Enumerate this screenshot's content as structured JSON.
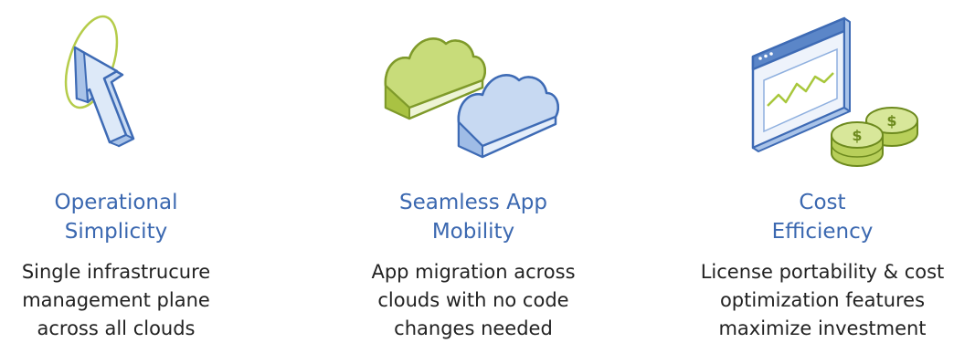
{
  "features": [
    {
      "icon": "cursor-arrow-icon",
      "title_lines": [
        "Operational",
        "Simplicity"
      ],
      "desc_lines": [
        "Single infrastrucure",
        "management plane",
        "across all clouds"
      ]
    },
    {
      "icon": "clouds-icon",
      "title_lines": [
        "Seamless App",
        "Mobility"
      ],
      "desc_lines": [
        "App migration across",
        "clouds with no code",
        "changes needed"
      ]
    },
    {
      "icon": "chart-coins-icon",
      "title_lines": [
        "Cost",
        "Efficiency"
      ],
      "desc_lines": [
        "License portability & cost",
        "optimization features",
        "maximize investment"
      ]
    }
  ],
  "colors": {
    "title": "#3b68b0",
    "text": "#222222",
    "green": "#a8c73c",
    "blue": "#5b86c8"
  }
}
